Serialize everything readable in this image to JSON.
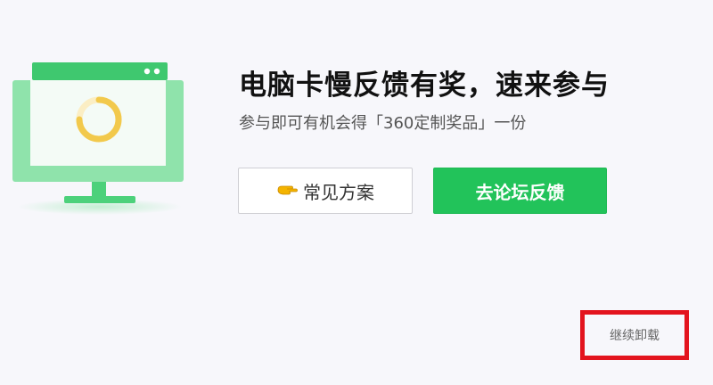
{
  "feedback": {
    "headline": "电脑卡慢反馈有奖，速来参与",
    "subline": "参与即可有机会得「360定制奖品」一份"
  },
  "actions": {
    "faq_label": "常见方案",
    "forum_label": "去论坛反馈",
    "continue_label": "继续卸载"
  },
  "icons": {
    "monitor": "monitor-loading-icon",
    "hand": "pointing-hand-icon"
  },
  "colors": {
    "accent_green": "#22c35a",
    "monitor_green": "#4cd17b",
    "spinner_yellow": "#f2c94c",
    "highlight_red": "#e3141e",
    "background": "#f7f7fb"
  }
}
